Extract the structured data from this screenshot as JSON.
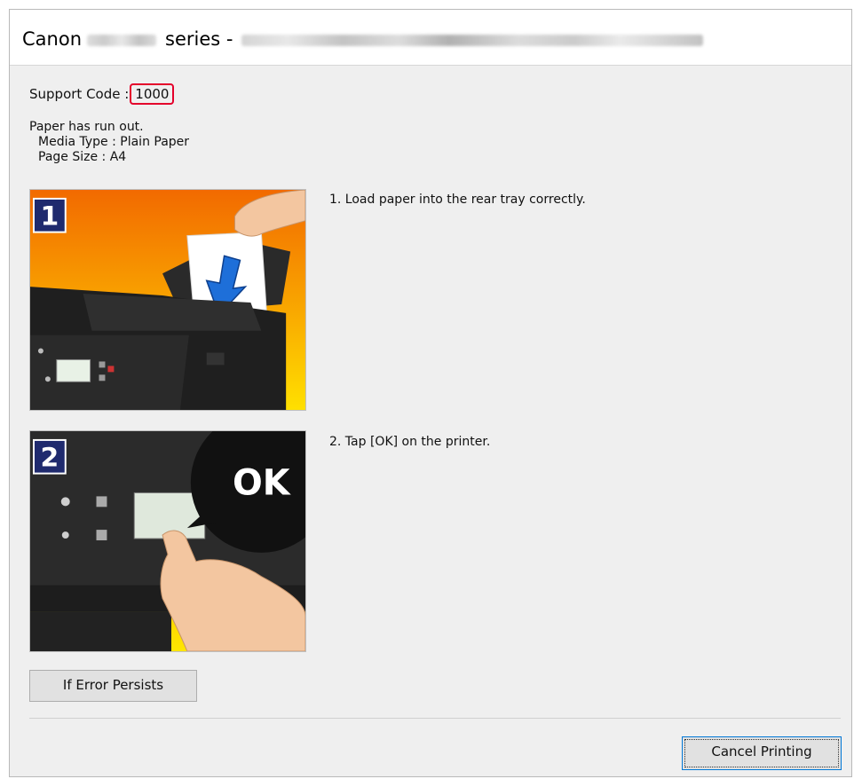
{
  "window": {
    "title_prefix": "Canon",
    "title_mid": "series -"
  },
  "support": {
    "label": "Support Code :",
    "code": "1000",
    "highlight_color": "#e4002b"
  },
  "message": {
    "line1": "Paper has run out.",
    "line2": "Media Type : Plain Paper",
    "line3": "Page Size : A4"
  },
  "steps": [
    {
      "number": "1",
      "text": "1.  Load paper into the rear tray correctly."
    },
    {
      "number": "2",
      "text": "2.  Tap [OK] on the printer.",
      "callout": "OK"
    }
  ],
  "buttons": {
    "if_error_persists": "If Error Persists",
    "cancel_printing": "Cancel Printing"
  },
  "colors": {
    "step_badge": "#1f2a6e",
    "illustration_bg_top": "#f57c00",
    "illustration_bg_bottom": "#ffd200",
    "focus_border": "#0078d7"
  },
  "icons": {
    "step1_image": "printer-load-paper-illustration",
    "step2_image": "printer-ok-button-illustration"
  }
}
